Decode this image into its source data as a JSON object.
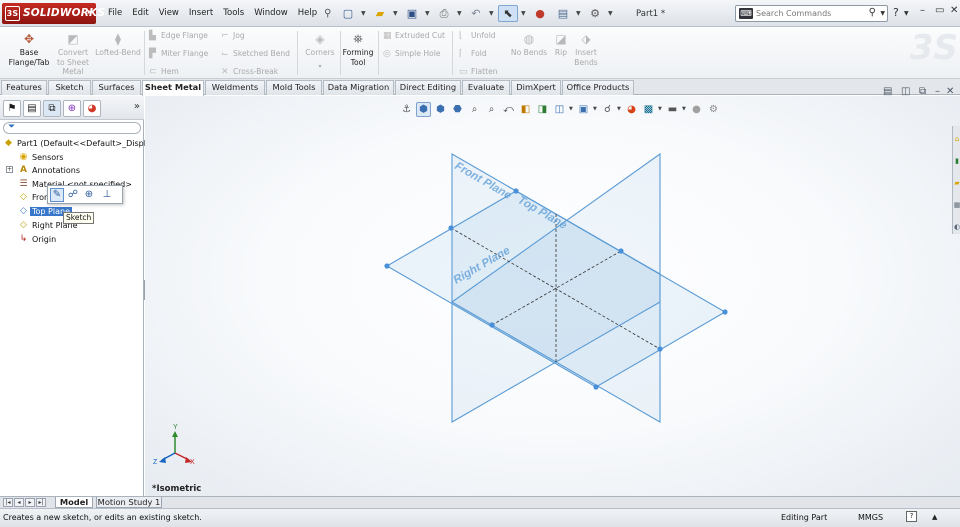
{
  "app": {
    "logo_text": "SOLIDWORKS",
    "document_title": "Part1 *"
  },
  "menubar": {
    "items": [
      "File",
      "Edit",
      "View",
      "Insert",
      "Tools",
      "Window",
      "Help"
    ]
  },
  "search": {
    "placeholder": "Search Commands"
  },
  "command_manager": {
    "base_flange": "Base Flange/Tab",
    "convert": "Convert to Sheet Metal",
    "lofted_bend": "Lofted-Bend",
    "edge_flange": "Edge Flange",
    "miter_flange": "Miter Flange",
    "hem": "Hem",
    "jog": "Jog",
    "sketched_bend": "Sketched Bend",
    "cross_break": "Cross-Break",
    "corners": "Corners",
    "forming_tool": "Forming Tool",
    "extruded_cut": "Extruded Cut",
    "simple_hole": "Simple Hole",
    "unfold": "Unfold",
    "fold": "Fold",
    "flatten": "Flatten",
    "no_bends": "No Bends",
    "rip": "Rip",
    "insert_bends": "Insert Bends"
  },
  "tabs": [
    {
      "label": "Features",
      "active": false
    },
    {
      "label": "Sketch",
      "active": false
    },
    {
      "label": "Surfaces",
      "active": false
    },
    {
      "label": "Sheet Metal",
      "active": true
    },
    {
      "label": "Weldments",
      "active": false
    },
    {
      "label": "Mold Tools",
      "active": false
    },
    {
      "label": "Data Migration",
      "active": false
    },
    {
      "label": "Direct Editing",
      "active": false
    },
    {
      "label": "Evaluate",
      "active": false
    },
    {
      "label": "DimXpert",
      "active": false
    },
    {
      "label": "Office Products",
      "active": false
    }
  ],
  "feature_tree": {
    "root": "Part1  (Default<<Default>_Displa",
    "items": [
      "Sensors",
      "Annotations",
      "Material <not specified>",
      "Front Plane",
      "Top Plane",
      "Right Plane",
      "Origin"
    ],
    "selected": "Top Plane",
    "tooltip": "Sketch"
  },
  "viewport": {
    "view_label": "*Isometric",
    "planes": {
      "front": "Front Plane",
      "top": "Top Plane",
      "right": "Right Plane"
    },
    "axes": {
      "x": "X",
      "y": "Y",
      "z": "Z"
    },
    "plane_color": "#5b9bd5"
  },
  "bottom_tabs": [
    {
      "label": "Model",
      "active": true
    },
    {
      "label": "Motion Study 1",
      "active": false
    }
  ],
  "status": {
    "message": "Creates a new sketch, or edits an existing sketch.",
    "mode": "Editing Part",
    "units": "MMGS",
    "help": "?"
  }
}
